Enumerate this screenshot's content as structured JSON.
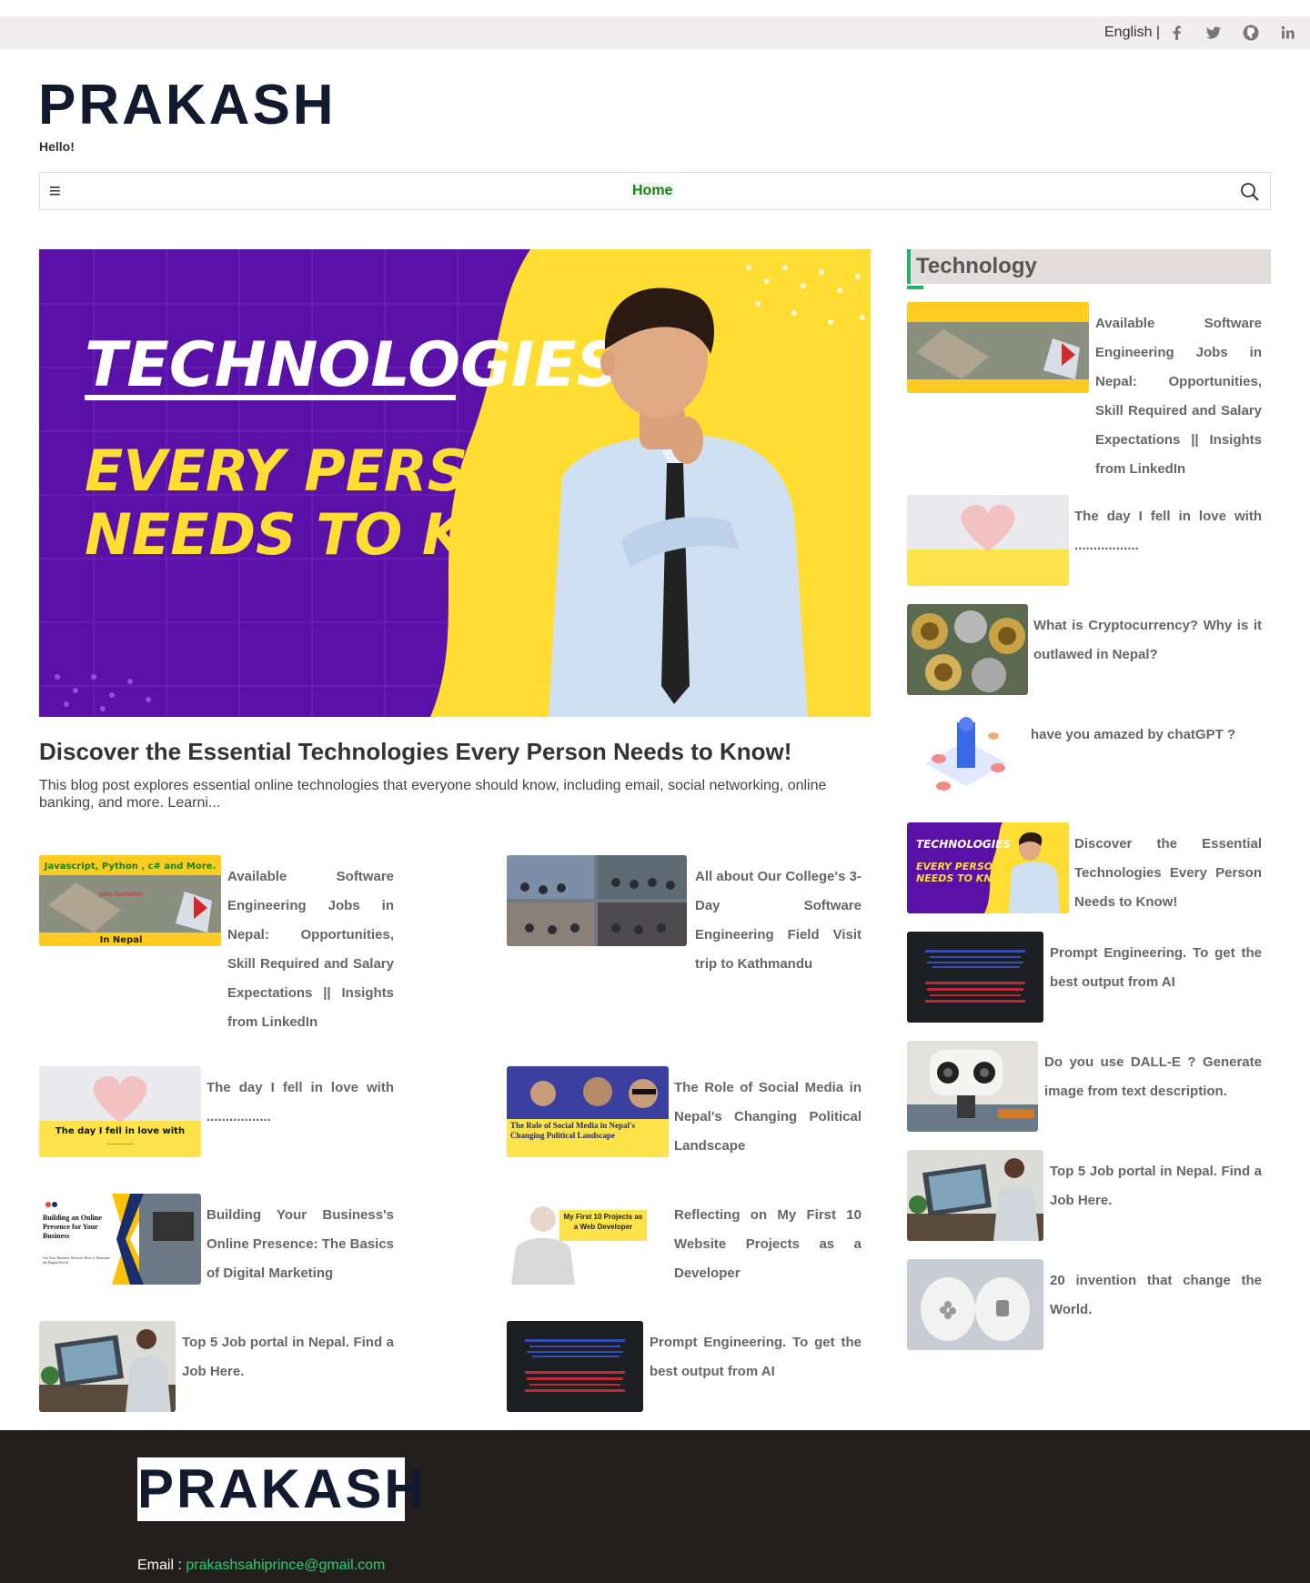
{
  "topbar": {
    "language": "English |",
    "social_icons": [
      "facebook-icon",
      "twitter-icon",
      "github-icon",
      "linkedin-icon"
    ]
  },
  "header": {
    "logo": "PRAKASH",
    "tagline": "Hello!"
  },
  "nav": {
    "menu_icon": "≡",
    "home": "Home",
    "search_icon": "search-icon"
  },
  "hero": {
    "image_line1": "TECHNOLOGIES",
    "image_line2": "EVERY PERSON",
    "image_line3": "NEEDS TO KNOW!",
    "title": "Discover the Essential Technologies Every Person Needs to Know!",
    "excerpt": "This blog post explores essential online technologies that everyone should know, including email, social networking, online banking, and more. Learni..."
  },
  "posts": [
    {
      "title": "Available Software Engineering Jobs in Nepal: Opportunities, Skill Required and Salary Expectations || Insights from LinkedIn",
      "thumb_text1": "Javascript, Python , c#  and More.",
      "thumb_text2": "Jobs Available",
      "thumb_text3": "In Nepal"
    },
    {
      "title": "All about Our College's 3-Day Software Engineering Field Visit trip to Kathmandu"
    },
    {
      "title": "The day I fell in love with .................",
      "thumb_text1": "The day I fell in love with",
      "thumb_text2": "............"
    },
    {
      "title": "The Role of Social Media in Nepal's Changing Political Landscape",
      "thumb_text1": "The Role of Social Media in Nepal's Changing Political Landscape"
    },
    {
      "title": "Building Your Business's Online Presence: The Basics of Digital Marketing",
      "thumb_text1": "Building an Online Presence for Your Business",
      "thumb_text2": "Get Your Business Noticed: How to Dominate the Digital World"
    },
    {
      "title": "Reflecting on My First 10 Website Projects as a Developer",
      "thumb_text1": "My First 10 Projects as a Web Developer"
    },
    {
      "title": "Top 5 Job portal in Nepal. Find a Job Here."
    },
    {
      "title": "Prompt Engineering. To get the best output from AI"
    }
  ],
  "sidebar": {
    "heading": "Technology",
    "items": [
      {
        "title": "Available Software Engineering Jobs in Nepal: Opportunities, Skill Required and Salary Expectations || Insights from LinkedIn"
      },
      {
        "title": "The day I fell in love with ................."
      },
      {
        "title": "What is Cryptocurrency? Why is it outlawed in Nepal?"
      },
      {
        "title": "have you amazed by chatGPT ?"
      },
      {
        "title": "Discover the Essential Technologies Every Person Needs to Know!"
      },
      {
        "title": "Prompt Engineering. To get the best output from AI"
      },
      {
        "title": "Do you use DALL-E ? Generate image from text description."
      },
      {
        "title": "Top 5 Job portal in Nepal. Find a Job Here."
      },
      {
        "title": "20 invention that change the World."
      }
    ]
  },
  "footer": {
    "logo": "PRAKASH",
    "email_label": "Email :",
    "email": "prakashsahiprince@gmail.com"
  },
  "colors": {
    "accent_green": "#22b36a",
    "nav_home": "#1a7f1a",
    "hero_purple": "#5a11a8",
    "hero_yellow": "#ffdd33",
    "footer_bg": "#241f1f"
  }
}
